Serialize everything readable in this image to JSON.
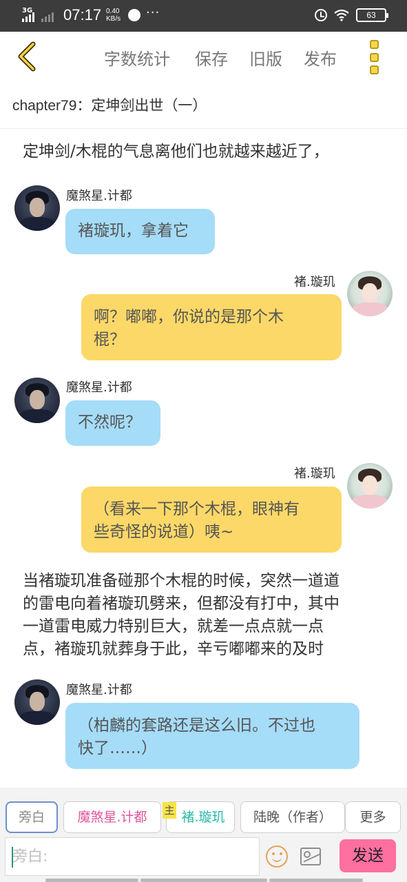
{
  "status_bar": {
    "network": "3G",
    "time": "07:17",
    "speed_value": "0.40",
    "speed_unit": "KB/s",
    "more": "···",
    "battery": "63"
  },
  "toolbar": {
    "word_count": "字数统计",
    "save": "保存",
    "old_version": "旧版",
    "publish": "发布"
  },
  "chapter_title": "chapter79：定坤剑出世（一）",
  "narration_1": "定坤剑/木棍的气息离他们也就越来越近了，",
  "messages": [
    {
      "speaker": "魔煞星.计都",
      "line1": "褚璇玑，拿着它",
      "line2": ""
    },
    {
      "speaker": "褚.璇玑",
      "line1": "啊？嘟嘟，你说的是那个木",
      "line2": "棍？"
    },
    {
      "speaker": "魔煞星.计都",
      "line1": "不然呢？",
      "line2": ""
    },
    {
      "speaker": "褚.璇玑",
      "line1": "（看来一下那个木棍，眼神有",
      "line2": "些奇怪的说道）咦~"
    },
    {
      "speaker": "魔煞星.计都",
      "line1": "（柏麟的套路还是这么旧。不过也",
      "line2": "快了……）"
    }
  ],
  "narration_2": [
    "当褚璇玑准备碰那个木棍的时候，突然一道道",
    "的雷电向着褚璇玑劈来，但都没有打中，其中",
    "一道雷电威力特别巨大，就差一点点就一点",
    "点，褚璇玑就葬身于此，辛亏嘟嘟来的及时"
  ],
  "roles": {
    "narrator": "旁白",
    "jidu": "魔煞星.计都",
    "xuanji_tag": "主",
    "xuanji": "褚.璇玑",
    "author": "陆晚（作者）",
    "more": "更多"
  },
  "input": {
    "placeholder": "旁白:",
    "value": ""
  },
  "send_label": "发送",
  "colors": {
    "blue_bubble": "#a5dcf8",
    "yellow_bubble": "#fcd868",
    "send_button": "#ff6fa0",
    "jidu_text": "#e0559a",
    "xuanji_text": "#27b9a8"
  }
}
